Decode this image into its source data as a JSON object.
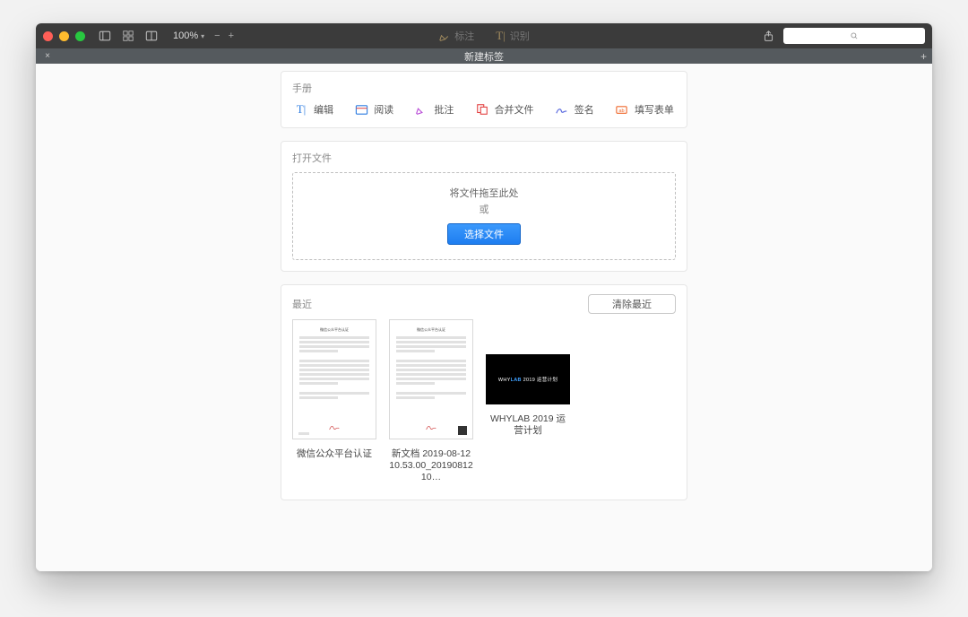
{
  "titlebar": {
    "zoom": "100%"
  },
  "modes": {
    "annotate": "标注",
    "ocr": "识别"
  },
  "tabbar": {
    "new_tab": "新建标签"
  },
  "manual": {
    "title": "手册",
    "tools": {
      "edit": "编辑",
      "read": "阅读",
      "annotate": "批注",
      "merge": "合并文件",
      "sign": "签名",
      "fillform": "填写表单"
    }
  },
  "openfile": {
    "title": "打开文件",
    "drop_line1": "将文件拖至此处",
    "drop_line2": "或",
    "choose_button": "选择文件"
  },
  "recent": {
    "title": "最近",
    "clear_button": "清除最近",
    "items": [
      {
        "label": "微信公众平台认证"
      },
      {
        "label": "新文档 2019-08-12 10.53.00_2019081210…"
      },
      {
        "label": "WHYLAB 2019 运营计划"
      }
    ]
  },
  "thumb_doc_title": "微信公众平台认证",
  "whylab_thumb_text_prefix": "WHY",
  "whylab_thumb_text_mid": "LAB",
  "whylab_thumb_text_suffix": " 2019 运营计划"
}
